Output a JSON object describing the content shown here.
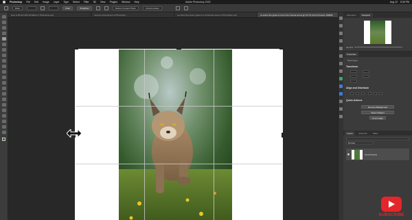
{
  "menubar": {
    "app_name": "Photoshop",
    "items": [
      "File",
      "Edit",
      "Image",
      "Layer",
      "Type",
      "Select",
      "Filter",
      "3D",
      "View",
      "Plugins",
      "Window",
      "Help"
    ],
    "window_title": "Adobe Photoshop 2022",
    "status": [
      "Aug 12",
      "5:39 PM"
    ]
  },
  "options": {
    "ratio": "Ratio",
    "clear": "Clear",
    "straighten": "Straighten",
    "delete_cropped": "Delete Cropped Pixels",
    "content_aware": "Content-Aware"
  },
  "tabs": [
    "How to fill text with 3D Effect in Photoshop.psd",
    "remove extra person in Photoshop...",
    "re-colour the green grass to a Christmas scene in Photoshop.psd",
    "re-colour the grass to red in the cinema scene @ 16.7% (Crop Preview, RGB/8)"
  ],
  "right_panel": {
    "top_tabs": [
      "Histogram",
      "Navigator"
    ],
    "nav_zoom": "16.67%",
    "properties_tabs": [
      "Properties"
    ],
    "pixel_layer": "Pixel Layer",
    "transform": "Transform",
    "align": "Align and Distribute",
    "quick_actions": "Quick Actions",
    "actions": [
      "Remove Background",
      "Select Subject",
      "Crop Image"
    ],
    "layers_tabs": [
      "Layers",
      "Channels",
      "Paths"
    ],
    "blend_mode": "Normal",
    "layer_name": "Crop Preview"
  },
  "subscribe": "SUBSCRIBE",
  "colors": {
    "accent_red": "#e3262b",
    "toolbar": "#3c3c3c",
    "canvas": "#282828"
  }
}
